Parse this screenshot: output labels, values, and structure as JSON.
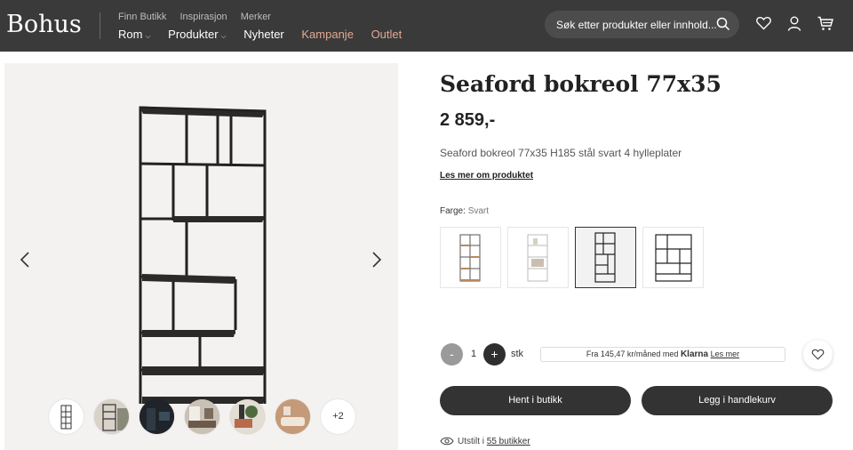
{
  "header": {
    "logo": "Bohus",
    "top_links": [
      "Finn Butikk",
      "Inspirasjon",
      "Merker"
    ],
    "nav": [
      {
        "label": "Rom",
        "has_dropdown": true
      },
      {
        "label": "Produkter",
        "has_dropdown": true
      },
      {
        "label": "Nyheter",
        "has_dropdown": false
      },
      {
        "label": "Kampanje",
        "has_dropdown": false,
        "color": "#e4a892"
      },
      {
        "label": "Outlet",
        "has_dropdown": false,
        "color": "#e4a892"
      }
    ],
    "search_placeholder": "Søk etter produkter eller innhold...",
    "icons": [
      "search-icon",
      "heart-icon",
      "user-icon",
      "cart-icon"
    ]
  },
  "gallery": {
    "thumb_count_visible": 6,
    "more_label": "+2"
  },
  "product": {
    "title": "Seaford bokreol 77x35",
    "price": "2 859,-",
    "description": "Seaford bokreol 77x35 H185 stål svart 4 hylleplater",
    "read_more": "Les mer om produktet",
    "color_label": "Farge:",
    "color_value": "Svart",
    "swatch_count": 4,
    "selected_swatch": 3
  },
  "purchase": {
    "minus": "-",
    "quantity": "1",
    "plus": "+",
    "unit": "stk",
    "klarna_text": "Fra 145,47 kr/måned med",
    "klarna_brand": "Klarna",
    "klarna_link": "Les mer",
    "store_button": "Hent i butikk",
    "cart_button": "Legg i handlekurv",
    "stock_text": "Utstilt i",
    "stock_link": "55 butikker"
  },
  "colors": {
    "header_bg": "#3a3a3a",
    "accent": "#e4a892",
    "button_bg": "#333333"
  }
}
